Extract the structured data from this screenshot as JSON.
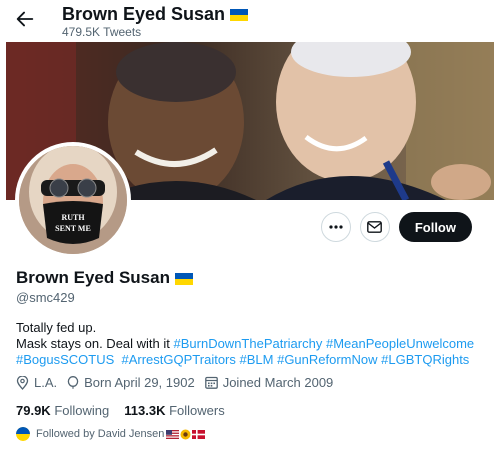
{
  "header": {
    "name": "Brown Eyed Susan",
    "tweet_count": "479.5K Tweets"
  },
  "profile": {
    "name": "Brown Eyed Susan",
    "handle": "@smc429",
    "avatar_mask_text": "RUTH SENT ME",
    "bio_line1": "Totally fed up.",
    "bio_line2": "Mask stays on. Deal with it ",
    "hashtags": [
      "#BurnDownThePatriarchy",
      "#MeanPeopleUnwelcome",
      "#BogusSCOTUS",
      "#ArrestGQPTraitors",
      "#BLM",
      "#GunReformNow",
      "#LGBTQRights"
    ],
    "location": "L.A.",
    "birthday": "Born April 29, 1902",
    "joined": "Joined March 2009",
    "following_count": "79.9K",
    "following_label": "Following",
    "followers_count": "113.3K",
    "followers_label": "Followers",
    "followed_by": "Followed by David Jensen"
  },
  "actions": {
    "follow_label": "Follow"
  },
  "icons": {
    "back": "arrow-left-icon",
    "more": "more-dots-icon",
    "message": "envelope-icon",
    "location": "location-pin-icon",
    "birthday": "balloon-icon",
    "joined": "calendar-icon"
  },
  "colors": {
    "link": "#1d9bf0",
    "text": "#0f1419",
    "muted": "#536471",
    "button": "#0f1419",
    "flag_blue": "#0057b7",
    "flag_yellow": "#ffd700"
  }
}
